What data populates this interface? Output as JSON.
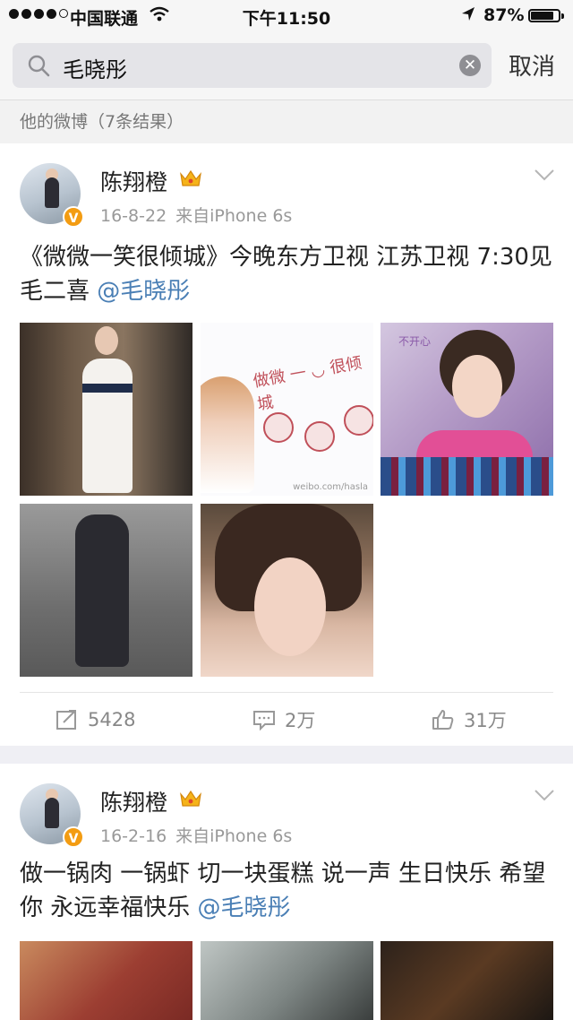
{
  "status_bar": {
    "carrier": "中国联通",
    "time": "下午11:50",
    "battery": "87%",
    "battery_level": 0.87
  },
  "search": {
    "query": "毛晓彤",
    "cancel_label": "取消"
  },
  "section": {
    "header": "他的微博（7条结果）"
  },
  "posts": [
    {
      "user": "陈翔橙",
      "date": "16-8-22",
      "source": "来自iPhone 6s",
      "text": "《微微一笑很倾城》今晚东方卫视 江苏卫视 7:30见 毛二喜 ",
      "mention": "@毛晓彤",
      "reposts": "5428",
      "comments": "2万",
      "likes": "31万"
    },
    {
      "user": "陈翔橙",
      "date": "16-2-16",
      "source": "来自iPhone 6s",
      "text": "做一锅肉 一锅虾 切一块蛋糕 说一声 生日快乐 希望你 永远幸福快乐 ",
      "mention": "@毛晓彤"
    }
  ],
  "photo_text": {
    "smile_caption": "做微 一 ◡ 很倾城",
    "watermark": "weibo.com/hasla",
    "p3_caption": "不开心"
  },
  "colors": {
    "link": "#4a7fb5",
    "badge": "#f39c12",
    "meta": "#999999"
  }
}
